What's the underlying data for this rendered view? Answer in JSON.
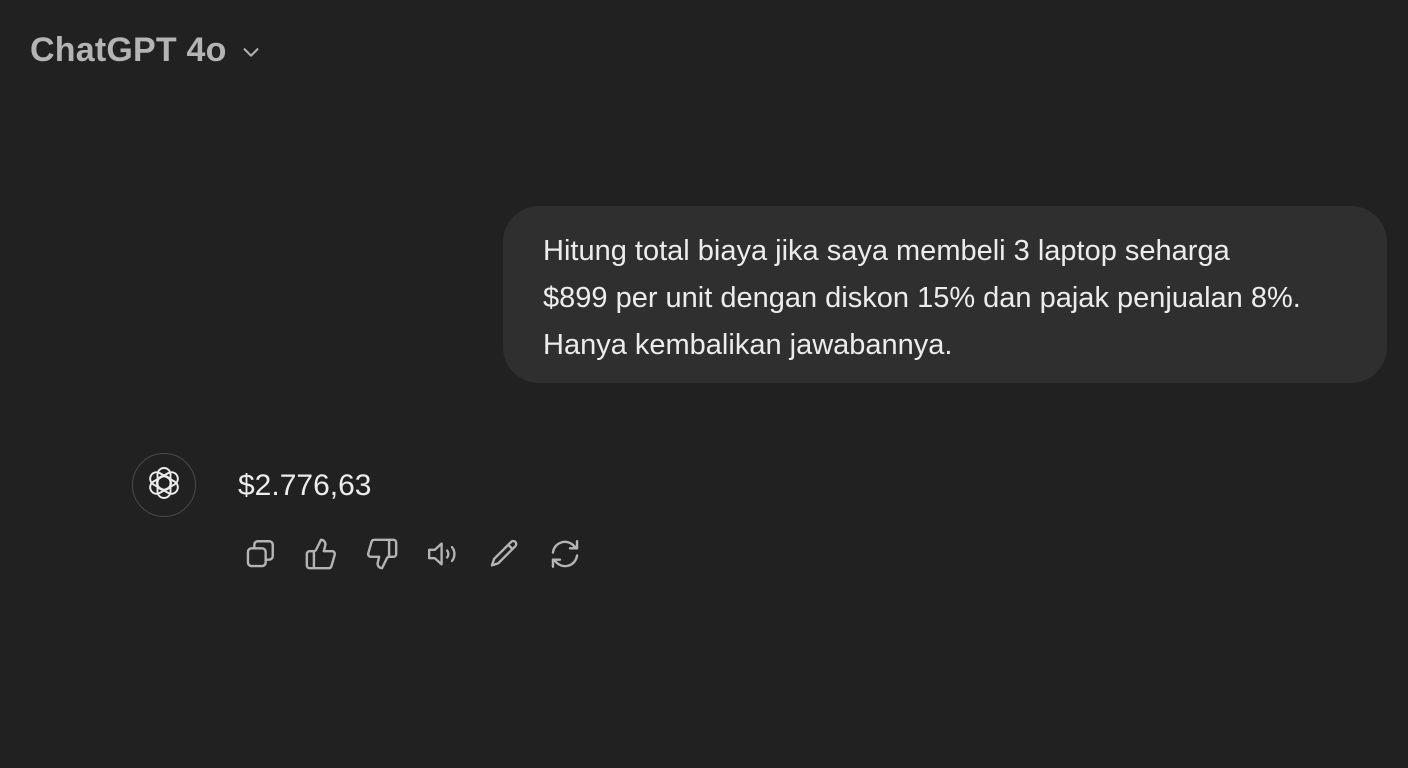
{
  "header": {
    "model_name": "ChatGPT 4o",
    "dropdown_icon": "chevron-down-icon"
  },
  "conversation": {
    "user_message": "Hitung total biaya jika saya membeli 3 laptop seharga\n$899 per unit dengan diskon 15% dan pajak penjualan 8%.\nHanya kembalikan jawabannya.",
    "assistant_avatar_icon": "openai-logo-icon",
    "assistant_message": "$2.776,63",
    "actions": [
      {
        "name": "copy-button",
        "icon": "copy-icon"
      },
      {
        "name": "thumbs-up-button",
        "icon": "thumbs-up-icon"
      },
      {
        "name": "thumbs-down-button",
        "icon": "thumbs-down-icon"
      },
      {
        "name": "read-aloud-button",
        "icon": "speaker-icon"
      },
      {
        "name": "edit-button",
        "icon": "pencil-icon"
      },
      {
        "name": "regenerate-button",
        "icon": "refresh-icon"
      }
    ]
  },
  "colors": {
    "background": "#212121",
    "user_bubble": "#2f2f2f",
    "text_primary": "#ececec",
    "text_secondary": "#b4b4b4",
    "icon": "#b4b4b4"
  }
}
